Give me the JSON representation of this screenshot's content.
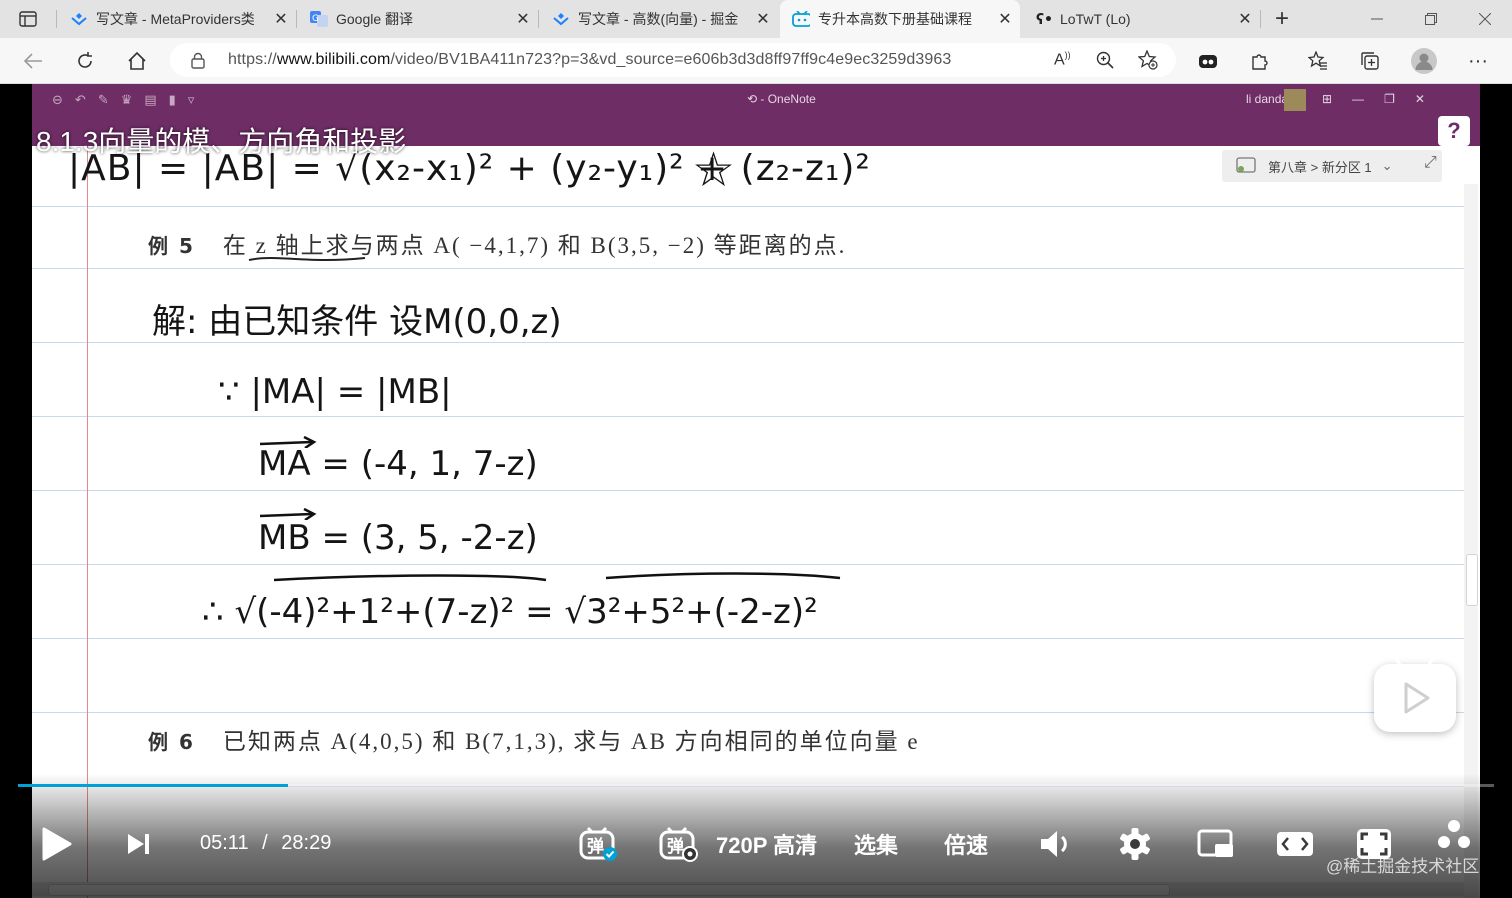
{
  "tabs": [
    {
      "title": "写文章 - MetaProviders类",
      "icon": "juejin-icon",
      "active": false
    },
    {
      "title": "Google 翻译",
      "icon": "translate-icon",
      "active": false
    },
    {
      "title": "写文章 - 高数(向量) - 掘金",
      "icon": "juejin-icon",
      "active": false
    },
    {
      "title": "专升本高数下册基础课程",
      "icon": "bilibili-icon",
      "active": true
    },
    {
      "title": "LoTwT (Lo)",
      "icon": "github-icon",
      "active": false
    }
  ],
  "address": {
    "prefix": "https://",
    "host": "www.bilibili.com",
    "path": "/video/BV1BA411n723?p=3&vd_source=e606b3d3d8ff97ff9c4e9ec3259d3963"
  },
  "onenote": {
    "title": "OneNote",
    "user": "li dandan",
    "breadcrumb": "第八章 > 新分区 1"
  },
  "video": {
    "title": "8.1.3向量的模、方向角和投影",
    "progress": 0.183
  },
  "notes": {
    "formula_top": "|AB| = |AB| = √(x₂-x₁)² + (y₂-y₁)² + (z₂-z₁)²",
    "star": "☆",
    "example5_label": "例 5",
    "example5_text": "在 z 轴上求与两点 A( −4,1,7) 和 B(3,5, −2) 等距离的点.",
    "hand_line1": "解: 由已知条件 设M(0,0,z)",
    "hand_line2": "∵ |MA| = |MB|",
    "hand_line3": "MA = (-4, 1, 7-z)",
    "hand_line4": "MB = (3, 5, -2-z)",
    "hand_line5": "∴ √(-4)²+1²+(7-z)² = √3²+5²+(-2-z)²",
    "example6_label": "例 6",
    "example6_text": "已知两点 A(4,0,5) 和 B(7,1,3), 求与 AB 方向相同的单位向量 e"
  },
  "controls": {
    "current_time": "05:11",
    "separator": "/",
    "duration": "28:29",
    "quality": "720P 高清",
    "episodes": "选集",
    "speed": "倍速",
    "danmaku_icon_text": "弹"
  },
  "watermark": "@稀土掘金技术社区",
  "colors": {
    "onenote_purple": "#6e2d65",
    "progress_blue": "#00a1d6",
    "bilibili_blue": "#00a1d6",
    "margin_red": "#e28a8a"
  }
}
